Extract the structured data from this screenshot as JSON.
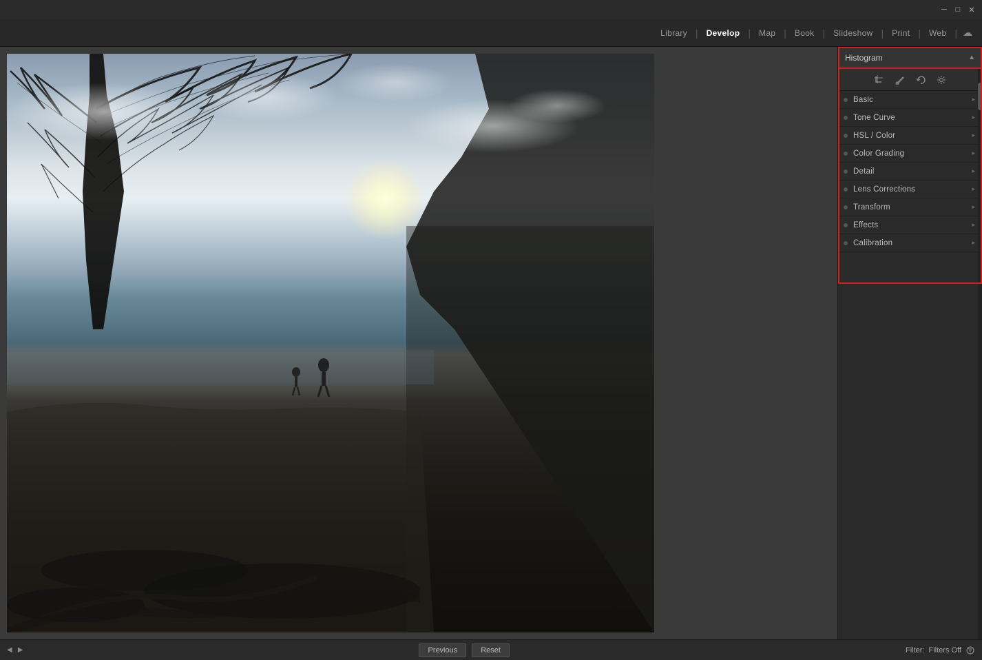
{
  "titlebar": {
    "minimize": "─",
    "maximize": "□",
    "close": "✕"
  },
  "nav": {
    "items": [
      {
        "label": "Library",
        "active": false
      },
      {
        "label": "Develop",
        "active": true
      },
      {
        "label": "Map",
        "active": false
      },
      {
        "label": "Book",
        "active": false
      },
      {
        "label": "Slideshow",
        "active": false
      },
      {
        "label": "Print",
        "active": false
      },
      {
        "label": "Web",
        "active": false
      }
    ]
  },
  "panel": {
    "histogram_label": "Histogram",
    "histogram_arrow": "▲",
    "tools": [
      "crop-icon",
      "brush-icon",
      "undo-icon",
      "settings-icon"
    ],
    "items": [
      {
        "label": "Basic",
        "arrow": "▸"
      },
      {
        "label": "Tone Curve",
        "arrow": "▸"
      },
      {
        "label": "HSL / Color",
        "arrow": "▸"
      },
      {
        "label": "Color Grading",
        "arrow": "▸"
      },
      {
        "label": "Detail",
        "arrow": "▸"
      },
      {
        "label": "Lens Corrections",
        "arrow": "▸"
      },
      {
        "label": "Transform",
        "arrow": "▸"
      },
      {
        "label": "Effects",
        "arrow": "▸"
      },
      {
        "label": "Calibration",
        "arrow": "▸"
      }
    ]
  },
  "bottom": {
    "prev_label": "Previous",
    "reset_label": "Reset",
    "filter_label": "Filter:",
    "filter_value": "Filters Off"
  }
}
